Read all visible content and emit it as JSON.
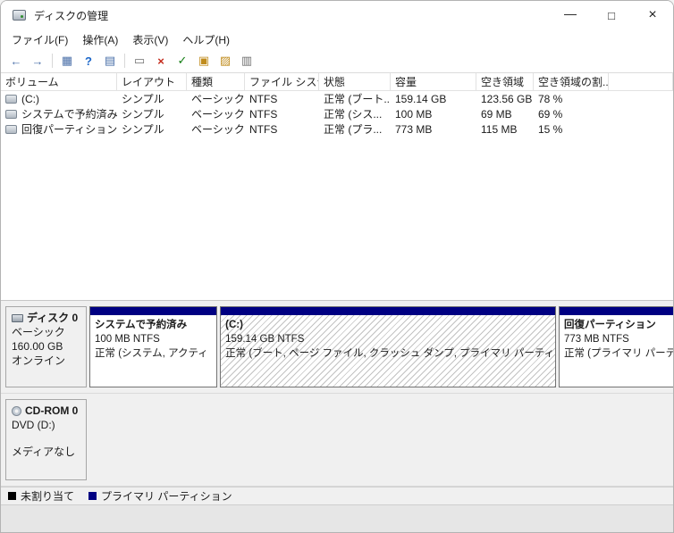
{
  "titlebar": {
    "title": "ディスクの管理",
    "controls": [
      {
        "name": "minimize",
        "glyph": "—"
      },
      {
        "name": "maximize",
        "glyph": "□"
      },
      {
        "name": "close",
        "glyph": "×"
      }
    ]
  },
  "menubar": {
    "items": [
      {
        "label": "ファイル(F)"
      },
      {
        "label": "操作(A)"
      },
      {
        "label": "表示(V)"
      },
      {
        "label": "ヘルプ(H)"
      }
    ]
  },
  "toolbar": {
    "icons": [
      {
        "name": "back",
        "glyph": "←"
      },
      {
        "name": "forward",
        "glyph": "→"
      },
      {
        "name": "show-console-tree",
        "glyph": "▦"
      },
      {
        "name": "help",
        "glyph": "?"
      },
      {
        "name": "show-action-pane",
        "glyph": "▤"
      },
      {
        "name": "properties",
        "glyph": "▭"
      },
      {
        "name": "delete-volume",
        "glyph": "×"
      },
      {
        "name": "mark-active",
        "glyph": "✓"
      },
      {
        "name": "open",
        "glyph": "▣"
      },
      {
        "name": "explore",
        "glyph": "▨"
      },
      {
        "name": "view-options",
        "glyph": "▥"
      }
    ]
  },
  "volumes": {
    "columns": [
      "ボリューム",
      "レイアウト",
      "種類",
      "ファイル システム",
      "状態",
      "容量",
      "空き領域",
      "空き領域の割..."
    ],
    "rows": [
      {
        "volume": "(C:)",
        "layout": "シンプル",
        "type": "ベーシック",
        "fs": "NTFS",
        "status": "正常 (ブート...",
        "capacity": "159.14 GB",
        "free": "123.56 GB",
        "free_pct": "78 %"
      },
      {
        "volume": "システムで予約済み",
        "layout": "シンプル",
        "type": "ベーシック",
        "fs": "NTFS",
        "status": "正常 (シス...",
        "capacity": "100 MB",
        "free": "69 MB",
        "free_pct": "69 %"
      },
      {
        "volume": "回復パーティション",
        "layout": "シンプル",
        "type": "ベーシック",
        "fs": "NTFS",
        "status": "正常 (プラ...",
        "capacity": "773 MB",
        "free": "115 MB",
        "free_pct": "15 %"
      }
    ]
  },
  "disks": [
    {
      "name": "ディスク 0",
      "type": "ベーシック",
      "size": "160.00 GB",
      "status": "オンライン",
      "partitions": [
        {
          "title": "システムで予約済み",
          "size": "100 MB NTFS",
          "status": "正常 (システム, アクティ"
        },
        {
          "title": "(C:)",
          "size": "159.14 GB NTFS",
          "status": "正常 (ブート, ページ ファイル, クラッシュ ダンプ, プライマリ パーティショ"
        },
        {
          "title": "回復パーティション",
          "size": "773 MB NTFS",
          "status": "正常 (プライマリ パーティション)"
        }
      ]
    },
    {
      "name": "CD-ROM 0",
      "type": "DVD (D:)",
      "size": "",
      "status": "メディアなし",
      "partitions": []
    }
  ],
  "legend": {
    "items": [
      {
        "label": "未割り当て",
        "color": "#000000"
      },
      {
        "label": "プライマリ パーティション",
        "color": "#000082"
      }
    ]
  }
}
